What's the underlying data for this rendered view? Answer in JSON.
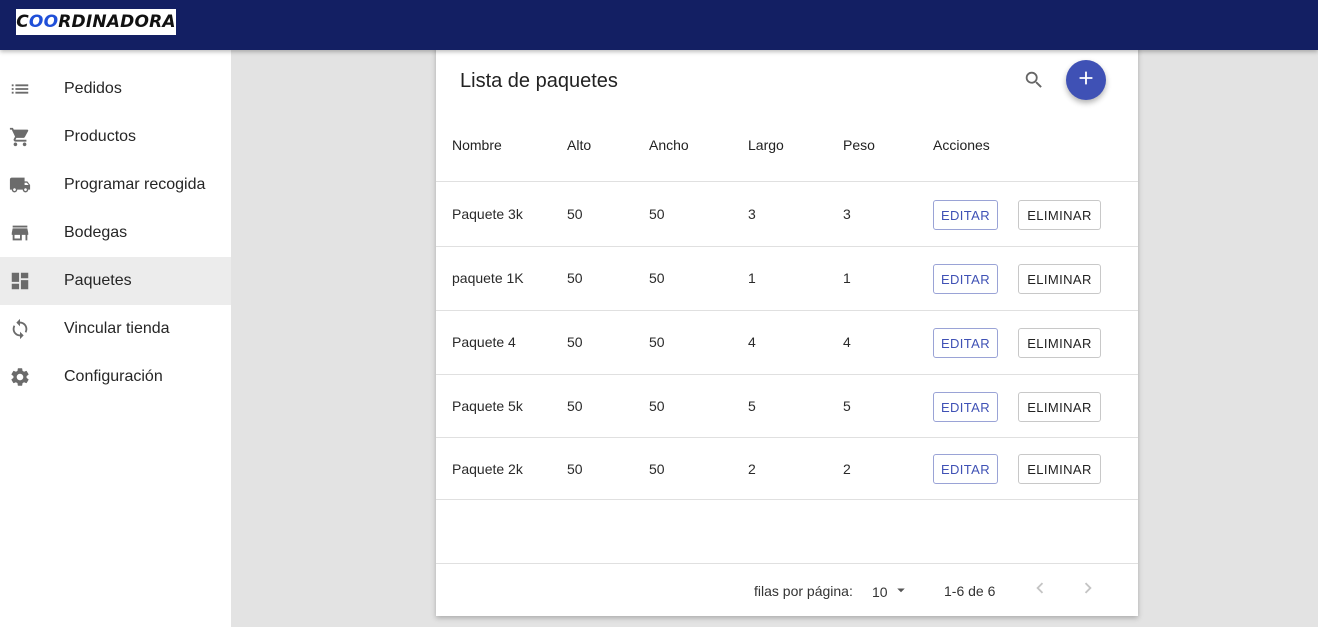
{
  "brand": {
    "logo_prefix": "C",
    "logo_oo": "OO",
    "logo_suffix": "RDINADORA"
  },
  "sidebar": {
    "items": [
      {
        "label": "Pedidos",
        "icon": "list-icon"
      },
      {
        "label": "Productos",
        "icon": "cart-icon"
      },
      {
        "label": "Programar recogida",
        "icon": "truck-icon"
      },
      {
        "label": "Bodegas",
        "icon": "store-icon"
      },
      {
        "label": "Paquetes",
        "icon": "dashboard-icon",
        "active": true
      },
      {
        "label": "Vincular tienda",
        "icon": "sync-icon"
      },
      {
        "label": "Configuración",
        "icon": "gear-icon"
      }
    ]
  },
  "card": {
    "title": "Lista de paquetes",
    "columns": [
      "Nombre",
      "Alto",
      "Ancho",
      "Largo",
      "Peso",
      "Acciones"
    ],
    "rows": [
      {
        "nombre": "Paquete 3k",
        "alto": "50",
        "ancho": "50",
        "largo": "3",
        "peso": "3"
      },
      {
        "nombre": "paquete 1K",
        "alto": "50",
        "ancho": "50",
        "largo": "1",
        "peso": "1"
      },
      {
        "nombre": "Paquete 4",
        "alto": "50",
        "ancho": "50",
        "largo": "4",
        "peso": "4"
      },
      {
        "nombre": "Paquete 5k",
        "alto": "50",
        "ancho": "50",
        "largo": "5",
        "peso": "5"
      },
      {
        "nombre": "Paquete 2k",
        "alto": "50",
        "ancho": "50",
        "largo": "2",
        "peso": "2"
      }
    ],
    "edit_label": "EDITAR",
    "delete_label": "ELIMINAR"
  },
  "pagination": {
    "rows_per_page_label": "filas por página:",
    "rows_per_page_value": "10",
    "range": "1-6 de 6"
  },
  "colors": {
    "appbar": "#131f63",
    "accent": "#3f51b5"
  }
}
